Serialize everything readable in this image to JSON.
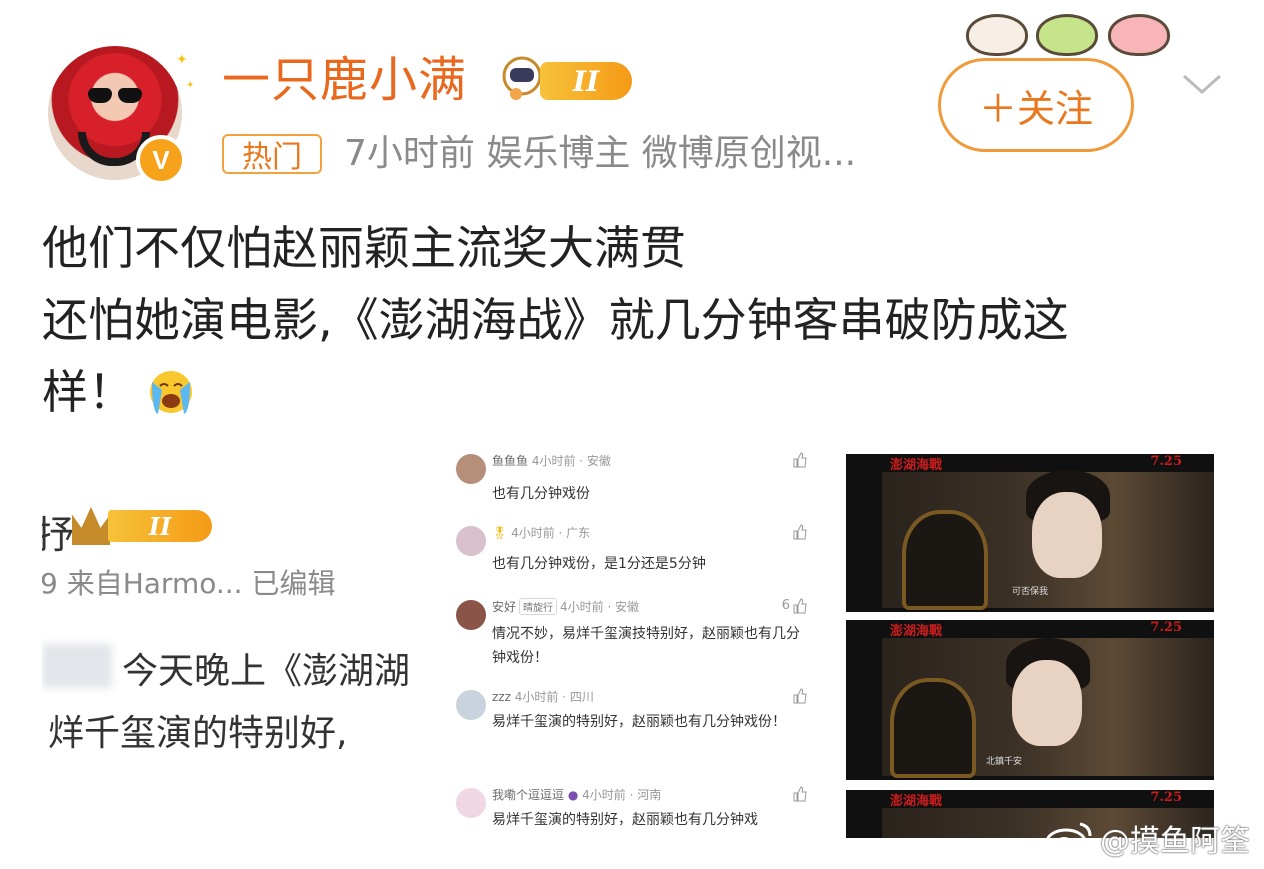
{
  "author": {
    "name": "一只鹿小满",
    "level": "II",
    "verified_mark": "V",
    "hot_tag": "热门",
    "meta": "7小时前  娱乐博主 微博原创视..."
  },
  "follow_button": {
    "label": "＋关注"
  },
  "post": {
    "lines": [
      "他们不仅怕赵丽颖主流奖大满贯",
      "还怕她演电影,《澎湖海战》就几分钟客串破防成这",
      "样！"
    ],
    "emoji": "crying-face"
  },
  "image1": {
    "partial_name": "抒",
    "level": "II",
    "source": "9  来自Harmo...  已编辑",
    "line1": "今天晚上《澎湖湖",
    "line2": "烊千玺演的特别好,"
  },
  "comments": [
    {
      "user": "鱼鱼鱼",
      "meta": "4小时前 · 安徽",
      "text": "也有几分钟戏份",
      "likes": ""
    },
    {
      "user": "",
      "meta": "4小时前 · 广东",
      "text": "也有几分钟戏份，是1分还是5分钟",
      "likes": ""
    },
    {
      "user": "安好",
      "tag": "晴旋行",
      "meta": "4小时前 · 安徽",
      "text": "情况不妙，易烊千玺演技特别好，赵丽颖也有几分钟戏份！",
      "likes": "6"
    },
    {
      "user": "zzz",
      "meta": "4小时前 · 四川",
      "text": "易烊千玺演的特别好，赵丽颖也有几分钟戏份！",
      "likes": ""
    },
    {
      "user": "我嘞个逗逗逗",
      "meta": "4小时前 · 河南",
      "text": "易烊千玺演的特别好，赵丽颖也有几分钟戏",
      "likes": ""
    }
  ],
  "frames": {
    "title": "澎湖海戰",
    "date": "7.25",
    "sub1": "可否保我",
    "sub2": "北鎮千安"
  },
  "watermark": "@摸鱼阿筌",
  "colors": {
    "accent": "#e8771e",
    "level_badge": "#f5a623",
    "meta_gray": "#8a8a8a"
  }
}
